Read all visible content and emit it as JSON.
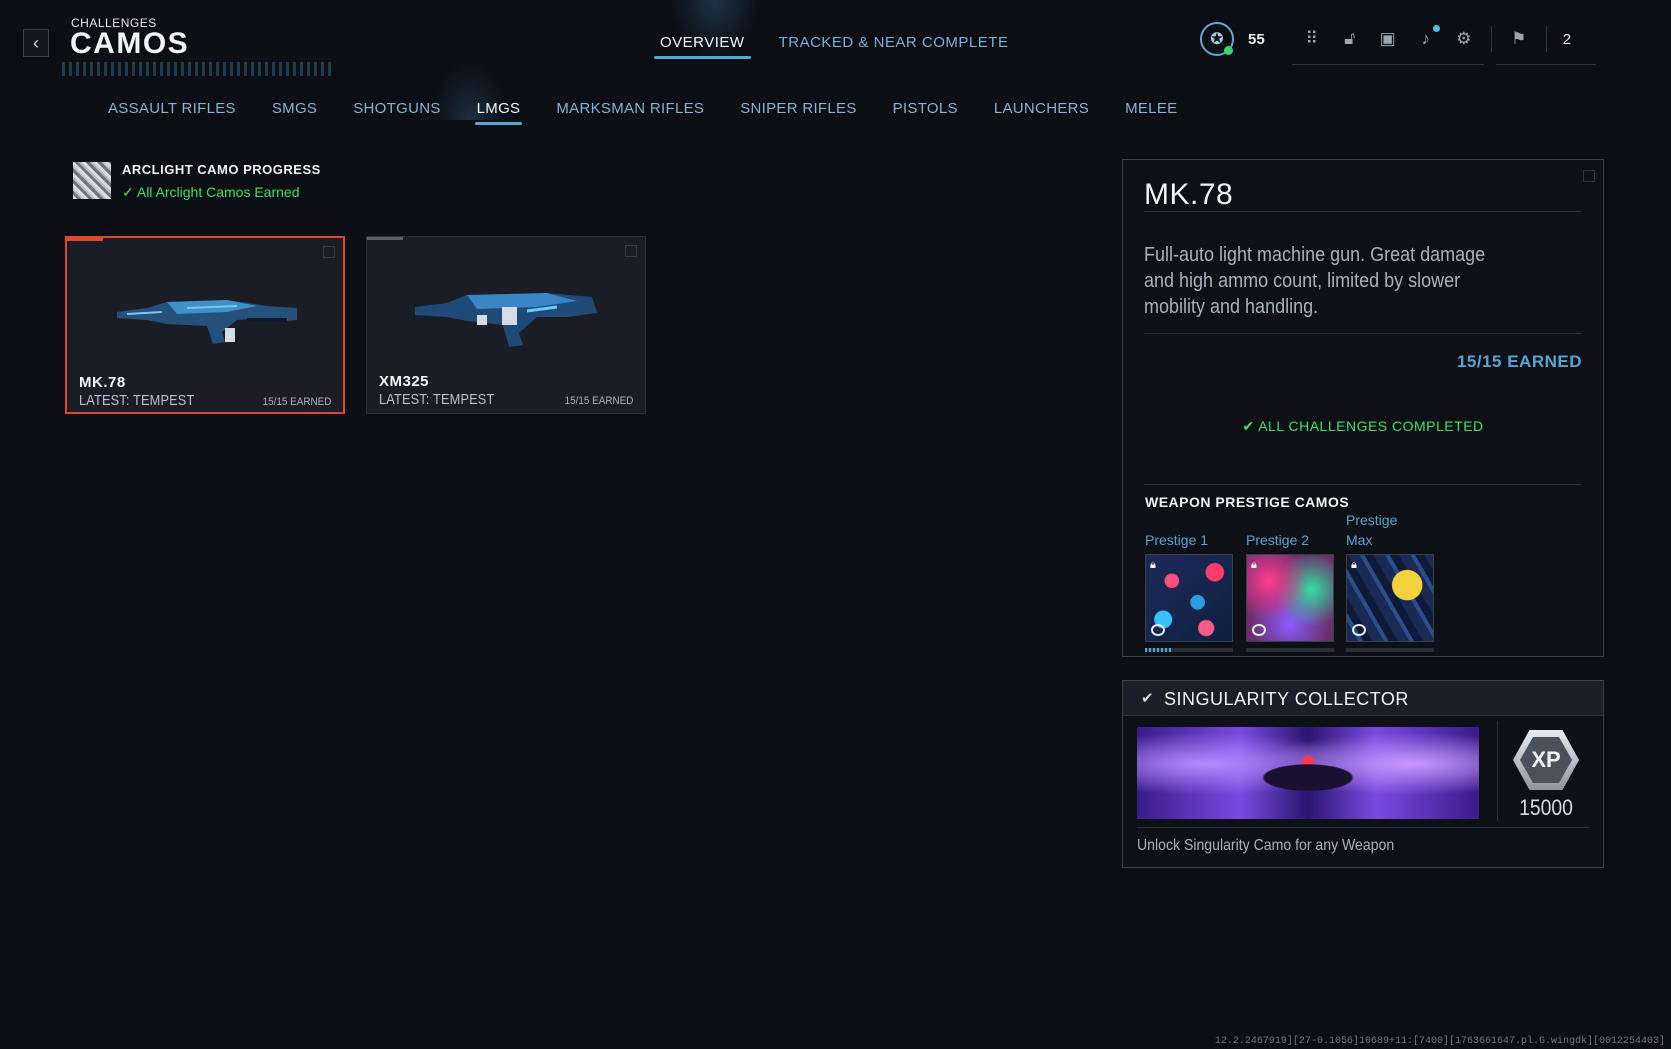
{
  "header": {
    "breadcrumb": "CHALLENGES",
    "title": "CAMOS",
    "tabs": [
      {
        "label": "OVERVIEW",
        "active": true
      },
      {
        "label": "TRACKED & NEAR COMPLETE",
        "active": false
      }
    ]
  },
  "hud": {
    "level": "55",
    "icons": [
      "grid-icon",
      "unlock-icon",
      "camera-icon",
      "bell-icon",
      "settings-icon",
      "party-icon"
    ],
    "party_count": "2"
  },
  "categories": [
    {
      "label": "ASSAULT RIFLES",
      "active": false
    },
    {
      "label": "SMGS",
      "active": false
    },
    {
      "label": "SHOTGUNS",
      "active": false
    },
    {
      "label": "LMGS",
      "active": true
    },
    {
      "label": "MARKSMAN RIFLES",
      "active": false
    },
    {
      "label": "SNIPER RIFLES",
      "active": false
    },
    {
      "label": "PISTOLS",
      "active": false
    },
    {
      "label": "LAUNCHERS",
      "active": false
    },
    {
      "label": "MELEE",
      "active": false
    }
  ],
  "arclight": {
    "title": "ARCLIGHT CAMO PROGRESS",
    "status": "All Arclight Camos Earned"
  },
  "weapons": [
    {
      "name": "MK.78",
      "latest": "LATEST: TEMPEST",
      "earned": "15/15 EARNED",
      "selected": true
    },
    {
      "name": "XM325",
      "latest": "LATEST: TEMPEST",
      "earned": "15/15 EARNED",
      "selected": false
    }
  ],
  "detail": {
    "name": "MK.78",
    "description": "Full-auto light machine gun. Great damage and high ammo count, limited by slower mobility and handling.",
    "earned": "15/15 EARNED",
    "status": "ALL CHALLENGES COMPLETED",
    "prestige_title": "WEAPON PRESTIGE CAMOS",
    "prestige_camos": [
      {
        "label": "Prestige 1",
        "locked": true,
        "progress": 0.3
      },
      {
        "label": "Prestige 2",
        "locked": true,
        "progress": 0
      },
      {
        "label": "Prestige Max",
        "locked": true,
        "progress": 0
      }
    ]
  },
  "collector": {
    "title": "SINGULARITY COLLECTOR",
    "xp_label": "XP",
    "xp_value": "15000",
    "description": "Unlock Singularity Camo for any Weapon"
  },
  "footer": "12.2.2467919][27-0.1056]10689+11:[7400][1763661647.pl.G.wingdk][0012254403]"
}
